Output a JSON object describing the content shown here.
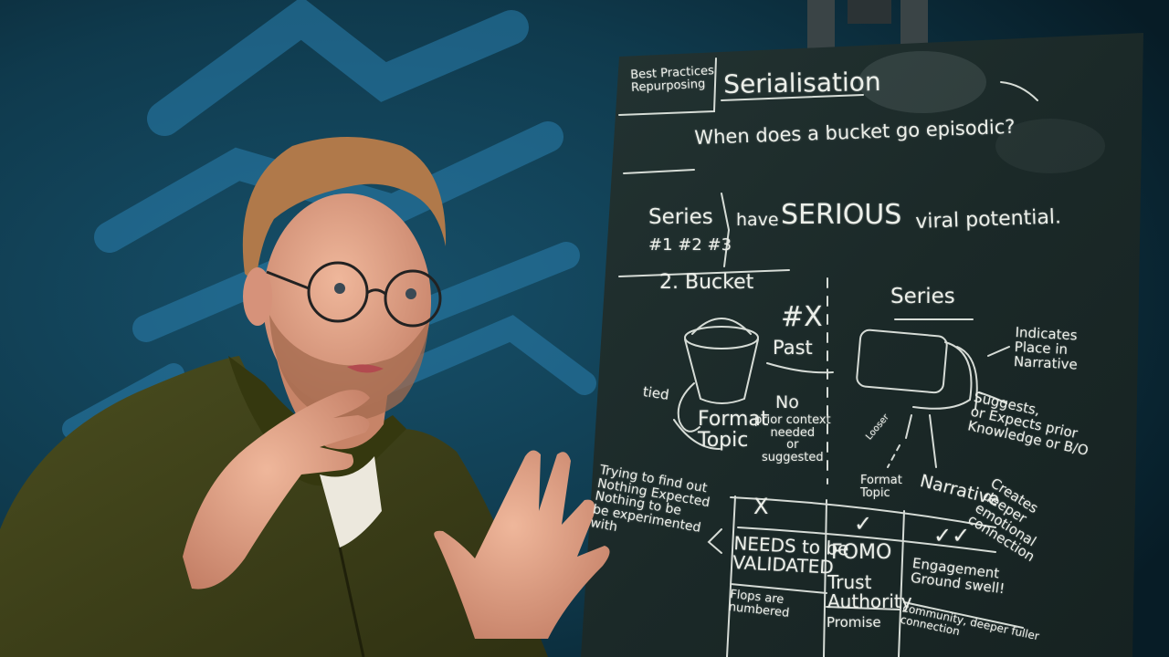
{
  "board": {
    "header_small": "Best Practices\nRepurposing",
    "header_title": "Serialisation",
    "question": "When does a bucket go episodic?",
    "series_word": "Series",
    "series_nums": "#1 #2 #3",
    "have_word": "have",
    "serious_word": "SERIOUS",
    "viral_words": "viral potential.",
    "bucket_label": "2. Bucket",
    "series_label": "Series",
    "hash_label": "#X",
    "past_label": "Past",
    "indicates": "Indicates\nPlace in\nNarrative",
    "tied": "tied",
    "no": "No",
    "prior": "prior context\nneeded\nor\nsuggested",
    "format_topic": "Format\nTopic",
    "suggests": "Suggests,\nor Expects prior\nKnowledge or B/O",
    "looser": "Looser",
    "format_topic2": "Format\nTopic",
    "narrative": "Narrative",
    "creates": "Creates\ndeeper\nemotional\nconnection",
    "trying": "Trying to find out\nNothing Expected\nNothing to be\nbe experimented\nwith",
    "table": {
      "x_mark": "X",
      "check1": "✓",
      "check2": "✓✓",
      "needs": "NEEDS to be\nVALIDATED",
      "flops": "Flops are\nnumbered",
      "fomo": "FOMO",
      "trust": "Trust\nAuthority",
      "promise": "Promise",
      "engaged": "Engagement\nGround swell!",
      "community": "community, deeper fuller\nconnection"
    }
  },
  "colors": {
    "wall": "#0b2a36",
    "board": "#1c2b2a",
    "chalk": "#ecefe9",
    "fleece": "#3f4219",
    "skin": "#e0a58a",
    "hair": "#b0794a"
  }
}
